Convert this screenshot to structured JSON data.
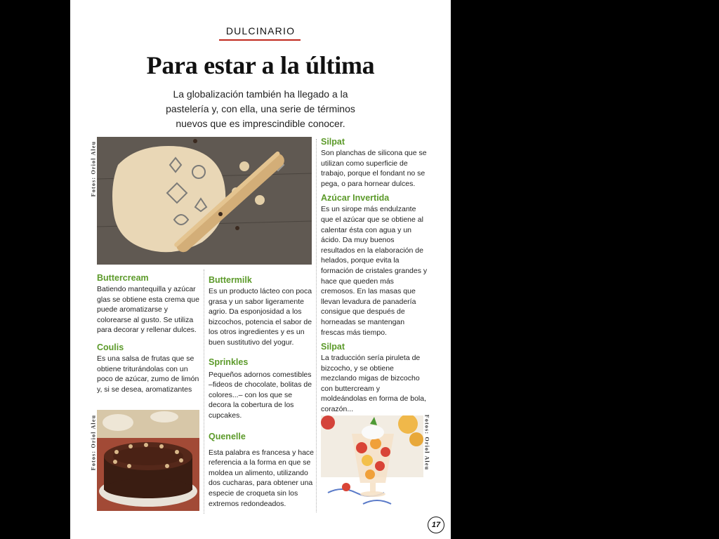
{
  "header": {
    "section": "DULCINARIO",
    "title": "Para estar a la última",
    "subtitle": "La globalización también ha llegado a la pastelería y, con ella, una serie de términos nuevos que es imprescindible conocer."
  },
  "credits": {
    "photo1": "Fotos: Oriol Aleu",
    "photo2": "Fotos: Oriol Aleu",
    "photo3": "Fotos: Oriol Aleu"
  },
  "photos": {
    "photo1": "dough-with-cookie-cutters-and-rolling-pin",
    "photo2": "chocolate-cake-with-nuts",
    "photo3": "fruit-salad-glass-with-cream"
  },
  "entries": {
    "buttercream": {
      "term": "Buttercream",
      "text": "Batiendo mantequilla y azúcar glas se obtiene esta crema que puede aromatizarse y colorearse al gusto. Se utiliza para decorar y rellenar dulces."
    },
    "coulis": {
      "term": "Coulis",
      "text": "Es una salsa de frutas que se obtiene triturándolas con un poco de azúcar, zumo de limón y, si se desea, aromatizantes"
    },
    "buttermilk": {
      "term": "Buttermilk",
      "text": "Es un producto lácteo con poca grasa y un sabor ligeramente agrio. Da esponjosidad a los bizcochos, potencia el sabor de los otros ingredientes y es un buen sustitutivo del yogur."
    },
    "sprinkles": {
      "term": "Sprinkles",
      "text": "Pequeños adornos comestibles –fideos de chocolate, bolitas de colores...– con los que se decora la cobertura de los cupcakes."
    },
    "quenelle": {
      "term": "Quenelle",
      "text": "Esta palabra es francesa y hace referencia a la forma en que se moldea un alimento, utilizando dos cucharas, para obtener una especie de croqueta sin los extremos redondeados."
    },
    "silpat": {
      "term": "Silpat",
      "text": "Son planchas de silicona que se utilizan como superficie de trabajo, porque el fondant no se pega, o para hornear dulces."
    },
    "azucar_invertida": {
      "term": "Azúcar Invertida",
      "text": "Es un sirope más endulzante que el azúcar que se obtiene al calentar ésta con agua y un ácido. Da muy buenos resultados en la elaboración de helados, porque evita la formación de cristales grandes y hace que queden más cremosos. En las masas que llevan levadura de panadería consigue que después de horneadas se mantengan frescas más tiempo."
    },
    "silpat2": {
      "term": "Silpat",
      "text": "La traducción sería piruleta de bizcocho, y se obtiene mezclando migas de bizcocho con buttercream y moldeándolas en forma de bola, corazón..."
    }
  },
  "page_number": "17"
}
